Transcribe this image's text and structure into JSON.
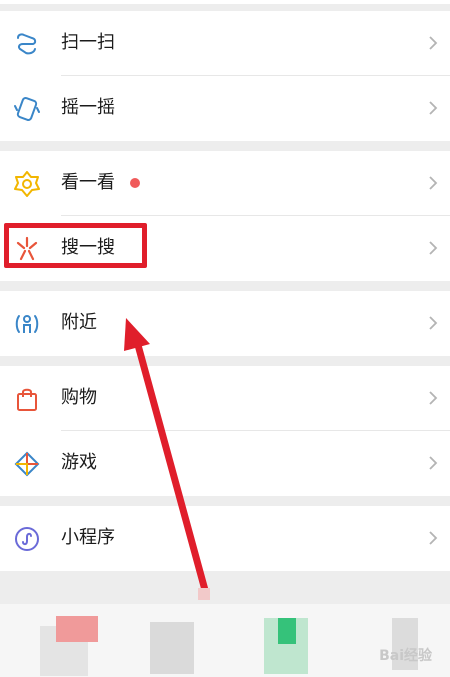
{
  "menu": {
    "scan_label": "扫一扫",
    "shake_label": "摇一摇",
    "top_stories_label": "看一看",
    "search_label": "搜一搜",
    "nearby_label": "附近",
    "shopping_label": "购物",
    "games_label": "游戏",
    "mini_programs_label": "小程序"
  },
  "icons": {
    "scan": "scan-icon",
    "shake": "shake-icon",
    "top_stories": "top-stories-icon",
    "search": "search-sparkle-icon",
    "nearby": "nearby-person-icon",
    "shopping": "shopping-bag-icon",
    "games": "games-diamond-icon",
    "mini_programs": "mini-programs-icon",
    "chevron": "chevron-right-icon"
  },
  "colors": {
    "highlight": "#e01e2b",
    "arrow": "#e01e2b",
    "badge": "#f05a5a"
  },
  "watermark": "Bai经验"
}
